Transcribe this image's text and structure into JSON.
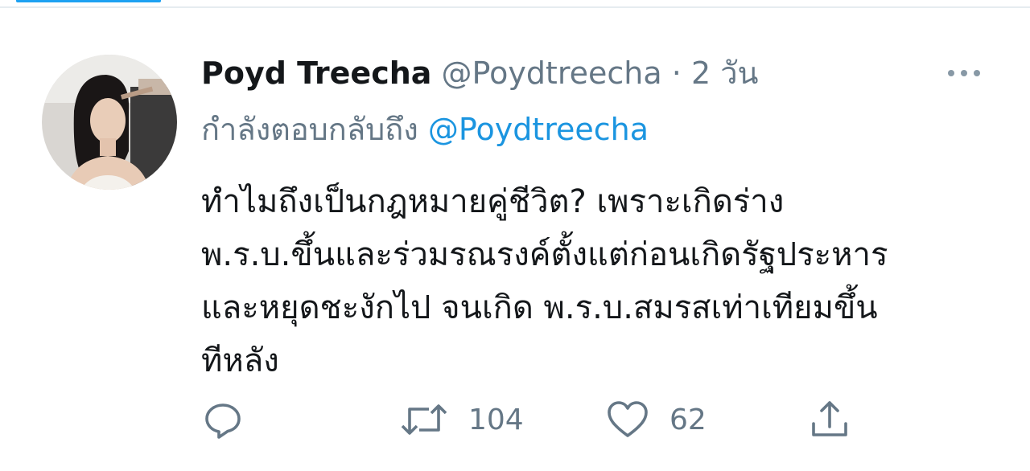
{
  "tweet": {
    "author_name": "Poyd Treecha",
    "author_handle": "@Poydtreecha",
    "separator": "·",
    "time": "2 วัน",
    "replying_prefix": "กำลังตอบกลับถึง",
    "replying_mention": "@Poydtreecha",
    "text_lines": [
      "ทำไมถึงเป็นกฎหมายคู่ชีวิต? เพราะเกิดร่าง",
      "พ.ร.บ.ขึ้นและร่วมรณรงค์ตั้งแต่ก่อนเกิดรัฐประหาร",
      "และหยุดชะงักไป จนเกิด พ.ร.บ.สมรสเท่าเทียมขึ้น",
      "ทีหลัง"
    ],
    "actions": {
      "reply_count": "",
      "retweet_count": "104",
      "like_count": "62"
    }
  },
  "colors": {
    "accent": "#1b95e0",
    "secondary_text": "#657786",
    "primary_text": "#14171a"
  },
  "icons": [
    "more-icon",
    "reply-icon",
    "retweet-icon",
    "like-icon",
    "share-icon"
  ]
}
